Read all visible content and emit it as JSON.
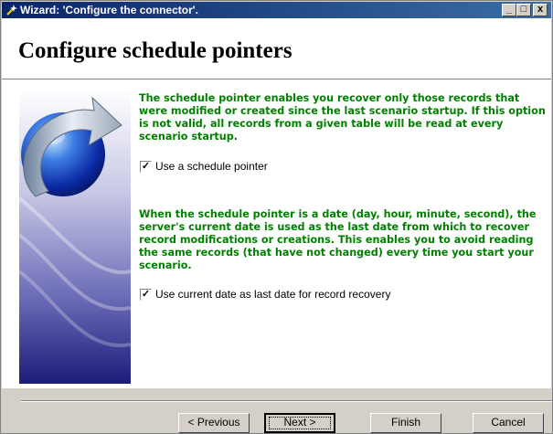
{
  "window": {
    "title": "Wizard: 'Configure the connector'.",
    "controls": {
      "minimize": "_",
      "maximize": "□",
      "close": "x"
    }
  },
  "header": {
    "title": "Configure schedule pointers"
  },
  "content": {
    "paragraph1": "The schedule pointer enables you recover only those records that were modified or created since the last scenario startup. If this option is not valid, all records from a given table will be read at every scenario startup.",
    "checkbox1": {
      "label": "Use a schedule pointer",
      "checked": true,
      "mark": "✓"
    },
    "paragraph2": "When the schedule pointer is a date (day, hour, minute, second), the server's current date is used as the last date from which to recover record modifications or creations. This enables you to avoid reading the same records (that have not changed) every time you start your scenario.",
    "checkbox2": {
      "label": "Use current date as last date for record recovery",
      "checked": true,
      "mark": "✓"
    }
  },
  "buttons": {
    "previous": "< Previous",
    "next": "Next >",
    "finish": "Finish",
    "cancel": "Cancel"
  },
  "colors": {
    "accent_text": "#008000",
    "title_bar": "#0a246a",
    "face": "#d4d0c8"
  },
  "icons": {
    "app": "wizard-app-icon",
    "art": "globe-arrow-illustration"
  }
}
